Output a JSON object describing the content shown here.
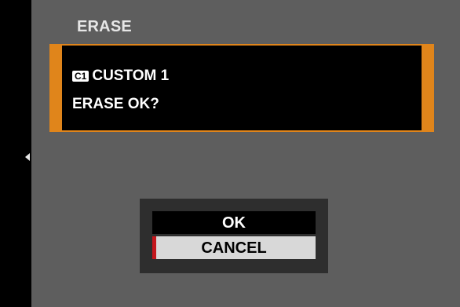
{
  "screen": {
    "title": "ERASE"
  },
  "message": {
    "badge": "C1",
    "profile_name": "CUSTOM 1",
    "prompt": "ERASE OK?"
  },
  "dialog": {
    "options": [
      {
        "label": "OK",
        "selected": false
      },
      {
        "label": "CANCEL",
        "selected": true
      }
    ]
  },
  "colors": {
    "accent": "#e0851b",
    "cursor": "#c4161c",
    "panel_bg": "#5e5e5e"
  },
  "icons": {
    "nav_back": "left-arrow-icon",
    "profile_badge": "c1-badge-icon"
  }
}
